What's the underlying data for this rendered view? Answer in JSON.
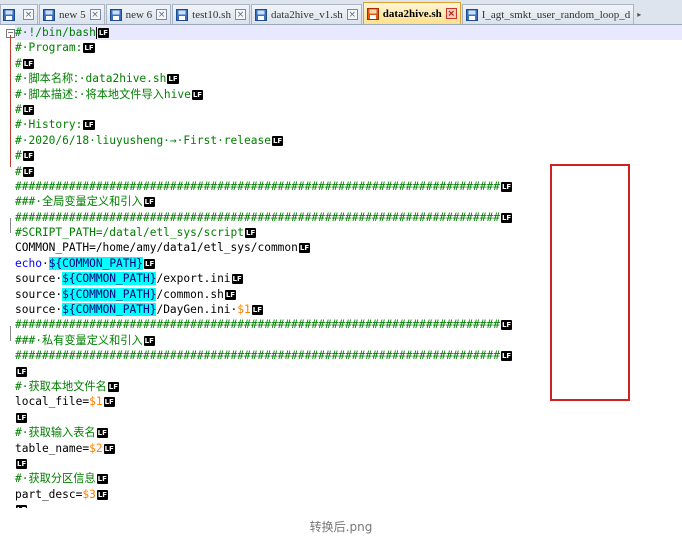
{
  "tabs": [
    {
      "label": "",
      "icon": "file-icon",
      "active": false
    },
    {
      "label": "new 5",
      "icon": "file-icon",
      "active": false
    },
    {
      "label": "new 6",
      "icon": "file-icon",
      "active": false
    },
    {
      "label": "test10.sh",
      "icon": "file-icon",
      "active": false
    },
    {
      "label": "data2hive_v1.sh",
      "icon": "file-icon",
      "active": false
    },
    {
      "label": "data2hive.sh",
      "icon": "file-icon-modified",
      "active": true
    },
    {
      "label": "I_agt_smkt_user_random_loop_d",
      "icon": "file-icon",
      "active": false
    }
  ],
  "eol_marker": "LF",
  "lines": [
    {
      "tokens": [
        {
          "t": "comment",
          "v": "#·!/bin/bash"
        }
      ],
      "caret": true
    },
    {
      "tokens": [
        {
          "t": "comment",
          "v": "#·Program:"
        }
      ]
    },
    {
      "tokens": [
        {
          "t": "comment",
          "v": "#"
        }
      ]
    },
    {
      "tokens": [
        {
          "t": "comment",
          "v": "#·脚本名称：·data2hive.sh"
        }
      ]
    },
    {
      "tokens": [
        {
          "t": "comment",
          "v": "#·脚本描述：·将本地文件导入hive"
        }
      ]
    },
    {
      "tokens": [
        {
          "t": "comment",
          "v": "#"
        }
      ]
    },
    {
      "tokens": [
        {
          "t": "comment",
          "v": "#·History:"
        }
      ]
    },
    {
      "tokens": [
        {
          "t": "comment",
          "v": "#·2020/6/18·liuyusheng·→·First·release"
        }
      ]
    },
    {
      "tokens": [
        {
          "t": "comment",
          "v": "#"
        }
      ]
    },
    {
      "tokens": [
        {
          "t": "comment",
          "v": "#"
        }
      ]
    },
    {
      "tokens": [
        {
          "t": "comment",
          "v": "########################################################################"
        }
      ]
    },
    {
      "tokens": [
        {
          "t": "comment",
          "v": "###·全局变量定义和引入"
        }
      ]
    },
    {
      "tokens": [
        {
          "t": "comment",
          "v": "########################################################################"
        }
      ]
    },
    {
      "tokens": [
        {
          "t": "comment",
          "v": "#SCRIPT_PATH=/datal/etl_sys/script"
        }
      ]
    },
    {
      "tokens": [
        {
          "t": "plain",
          "v": "COMMON_PATH=/home/amy/data1/etl_sys/common"
        }
      ]
    },
    {
      "tokens": [
        {
          "t": "keyword",
          "v": "echo"
        },
        {
          "t": "plain",
          "v": "·"
        },
        {
          "t": "varhl",
          "v": "${COMMON_PATH}"
        }
      ]
    },
    {
      "tokens": [
        {
          "t": "plain",
          "v": "source·"
        },
        {
          "t": "varhl",
          "v": "${COMMON_PATH}"
        },
        {
          "t": "plain",
          "v": "/export.ini"
        }
      ]
    },
    {
      "tokens": [
        {
          "t": "plain",
          "v": "source·"
        },
        {
          "t": "varhl",
          "v": "${COMMON_PATH}"
        },
        {
          "t": "plain",
          "v": "/common.sh"
        }
      ]
    },
    {
      "tokens": [
        {
          "t": "plain",
          "v": "source·"
        },
        {
          "t": "varhl",
          "v": "${COMMON_PATH}"
        },
        {
          "t": "plain",
          "v": "/DayGen.ini·"
        },
        {
          "t": "param",
          "v": "$1"
        }
      ]
    },
    {
      "tokens": [
        {
          "t": "comment",
          "v": "########################################################################"
        }
      ]
    },
    {
      "tokens": [
        {
          "t": "comment",
          "v": "###·私有变量定义和引入"
        }
      ]
    },
    {
      "tokens": [
        {
          "t": "comment",
          "v": "########################################################################"
        }
      ]
    },
    {
      "tokens": []
    },
    {
      "tokens": [
        {
          "t": "comment",
          "v": "#·获取本地文件名"
        }
      ]
    },
    {
      "tokens": [
        {
          "t": "plain",
          "v": "local_file="
        },
        {
          "t": "param",
          "v": "$1"
        }
      ]
    },
    {
      "tokens": []
    },
    {
      "tokens": [
        {
          "t": "comment",
          "v": "#·获取输入表名"
        }
      ]
    },
    {
      "tokens": [
        {
          "t": "plain",
          "v": "table_name="
        },
        {
          "t": "param",
          "v": "$2"
        }
      ]
    },
    {
      "tokens": []
    },
    {
      "tokens": [
        {
          "t": "comment",
          "v": "#·获取分区信息"
        }
      ]
    },
    {
      "tokens": [
        {
          "t": "plain",
          "v": "part_desc="
        },
        {
          "t": "param",
          "v": "$3"
        }
      ]
    },
    {
      "tokens": []
    }
  ],
  "caption": "转换后.png",
  "colors": {
    "comment": "#008000",
    "keyword": "#0000ff",
    "variable_highlight": "#00ffff",
    "parameter": "#ff8000",
    "annotation_box": "#d02020"
  }
}
